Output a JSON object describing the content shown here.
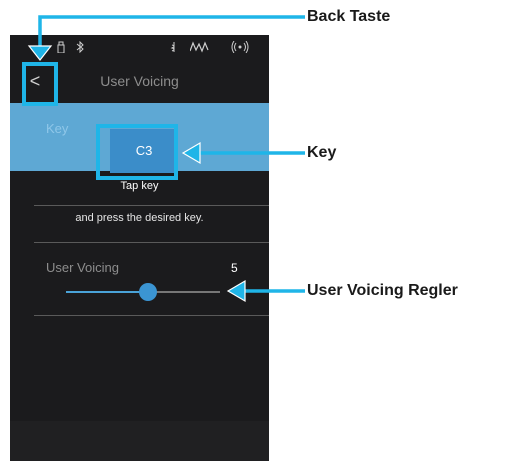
{
  "status_bar": {
    "icons": [
      "usb-icon",
      "bluetooth-icon",
      "metronome-icon",
      "equalizer-icon",
      "wifi-icon"
    ]
  },
  "header": {
    "back_glyph": "<",
    "title": "User Voicing"
  },
  "key_section": {
    "label": "Key",
    "value": "C3",
    "hint_line1": "Tap key",
    "hint_line2": "and press the desired key."
  },
  "voicing_section": {
    "label": "User Voicing",
    "value": "5",
    "slider_level_percent": 53
  },
  "callouts": {
    "back": "Back Taste",
    "key": "Key",
    "slider": "User Voicing Regler"
  },
  "colors": {
    "accent": "#1fb5e8",
    "panel": "#5ea8d4",
    "key_button": "#3b8dc9",
    "background": "#1b1b1d"
  }
}
